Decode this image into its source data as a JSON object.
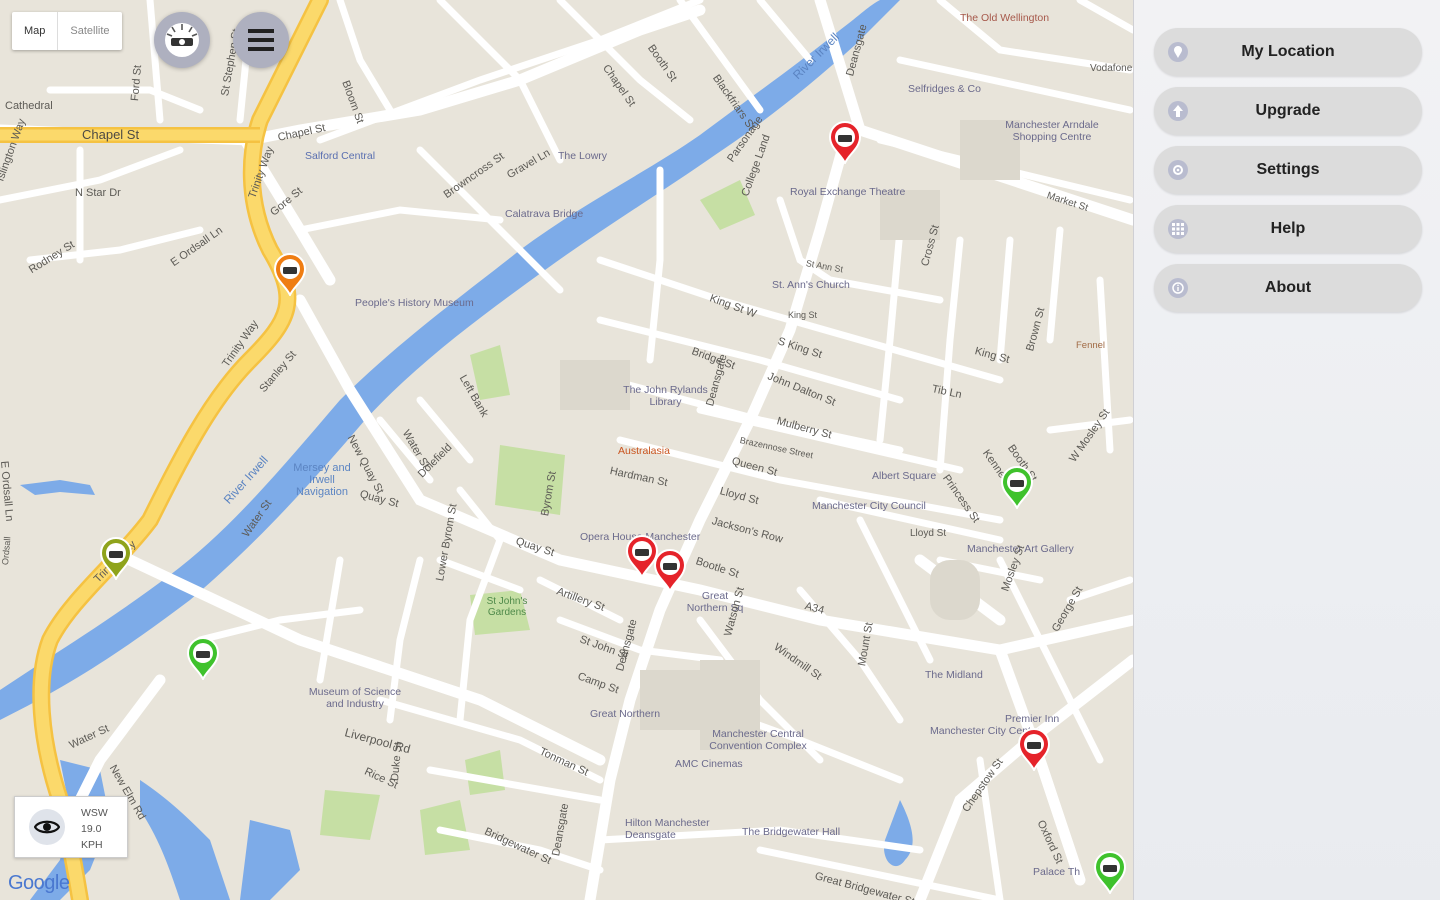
{
  "map": {
    "type_toggle": {
      "map_label": "Map",
      "satellite_label": "Satellite"
    },
    "attribution": "Google",
    "wind": {
      "direction": "WSW",
      "speed": "19.0",
      "unit": "KPH"
    },
    "labels": {
      "chapel_st": "Chapel St",
      "chapel_st2": "Chapel St",
      "cathedral": "Cathedral",
      "salford_central": "Salford Central",
      "n_star_dr": "N Star Dr",
      "rodney_st": "Rodney St",
      "e_ordsall_ln": "E Ordsall Ln",
      "e_ordsall_ln2": "E Ordsall Ln",
      "gore_st": "Gore St",
      "trinity_way": "Trinity Way",
      "trinity_way2": "Trinity Way",
      "trinity_way3": "Trinity Way",
      "the_lowry": "The Lowry",
      "browncross_st": "Browncross St",
      "calatrava_bridge": "Calatrava Bridge",
      "peoples_history": "People's History Museum",
      "stanley_st": "Stanley St",
      "river_irwell": "River Irwell",
      "river_irwell2": "River Irwell",
      "mersey_irwell": "Mersey and Irwell Navigation",
      "left_bank": "Left Bank",
      "new_quay_st": "New Quay St",
      "water_st": "Water St",
      "water_st2": "Water St",
      "water_st3": "Water St",
      "quay_st": "Quay St",
      "quay_st2": "Quay St",
      "dolefield": "Dolefield",
      "byrom_st": "Byrom St",
      "lower_byrom_st": "Lower Byrom St",
      "st_johns_gardens": "St John's Gardens",
      "artillery_st": "Artillery St",
      "st_john_st": "St John St",
      "camp_st": "Camp St",
      "museum_science": "Museum of Science and Industry",
      "liverpool_rd": "Liverpool Rd",
      "new_elm_rd": "New Elm Rd",
      "rice_st": "Rice St",
      "duke_st": "Duke St",
      "tonman_st": "Tonman St",
      "bridgewater_st": "Bridgewater St",
      "great_northern": "Great Northern",
      "manchester_central": "Manchester Central Convention Complex",
      "amc_cinemas": "AMC Cinemas",
      "hilton": "Hilton Manchester Deansgate",
      "bridgewater_hall": "The Bridgewater Hall",
      "great_bridgewater_st": "Great Bridgewater St",
      "deansgate": "Deansgate",
      "deansgate2": "Deansgate",
      "deansgate3": "Deansgate",
      "deansgate4": "Deansgate",
      "opera_house": "Opera House Manchester",
      "boote_st": "Bootle St",
      "great_northern_sq": "Great Northern Sq",
      "watson_st": "Watson St",
      "windmill_st": "Windmill St",
      "a34": "A34",
      "mount_st": "Mount St",
      "the_midland": "The Midland",
      "manchester_city_centre": "Manchester City Centre",
      "premier_inn": "Premier Inn",
      "oxford_st": "Oxford St",
      "chepstow_st": "Chepstow St",
      "palace_theatre": "Palace Th",
      "australasia": "Australasia",
      "hardman_st": "Hardman St",
      "queen_st": "Queen St",
      "lloyd_st": "Lloyd St",
      "lloyd_st2": "Lloyd St",
      "jacksons_row": "Jackson's Row",
      "mulberry_st": "Mulberry St",
      "brazennose_st": "Brazennose Street",
      "john_dalton_st": "John Dalton St",
      "s_king_st": "S King St",
      "king_st": "King St",
      "king_st_w": "King St W",
      "king_st2": "King St",
      "bridge_st": "Bridge St",
      "st_anns_church": "St. Ann's Church",
      "st_ann_st": "St Ann St",
      "royal_exchange": "Royal Exchange Theatre",
      "the_john_rylands": "The John Rylands Library",
      "albert_square": "Albert Square",
      "manchester_city_council": "Manchester City Council",
      "manchester_art_gallery": "Manchester Art Gallery",
      "tib_ln": "Tib Ln",
      "cross_st": "Cross St",
      "brown_st": "Brown St",
      "booth_st": "Booth St",
      "kennedy_st": "Kennedy St",
      "princess_st": "Princess St",
      "mosley_st": "Mosley St",
      "w_mosley_st": "W Mosley St",
      "george_st": "George St",
      "selfridges": "Selfridges & Co",
      "manchester_arndale": "Manchester Arndale Shopping Centre",
      "market_st": "Market St",
      "vodafone": "Vodafone",
      "old_wellington": "The Old Wellington",
      "blackfriars_st": "Blackfriars St",
      "parsonage": "Parsonage",
      "college_land": "College Land",
      "chapel_st3": "Chapel St",
      "booth_st2": "Booth St",
      "gravel_ln": "Gravel Ln",
      "bloom_st": "Bloom St",
      "islington_way": "Islington Way",
      "ford_st": "Ford St",
      "st_stephen_st": "St Stephen St",
      "fennel": "Fennel",
      "ordsall": "Ordsall"
    }
  },
  "panel": {
    "items": [
      {
        "label": "My Location",
        "icon": "location-pin-icon"
      },
      {
        "label": "Upgrade",
        "icon": "upgrade-arrow-icon"
      },
      {
        "label": "Settings",
        "icon": "settings-gear-icon"
      },
      {
        "label": "Help",
        "icon": "help-grid-icon"
      },
      {
        "label": "About",
        "icon": "info-icon"
      }
    ]
  },
  "colors": {
    "pin_red": "#e5232a",
    "pin_green": "#3fc22c",
    "pin_orange": "#ef7d12",
    "pin_olive": "#8fa31b",
    "highway": "#f7ce53",
    "water": "#7dabe8",
    "park": "#c6dfa4"
  }
}
